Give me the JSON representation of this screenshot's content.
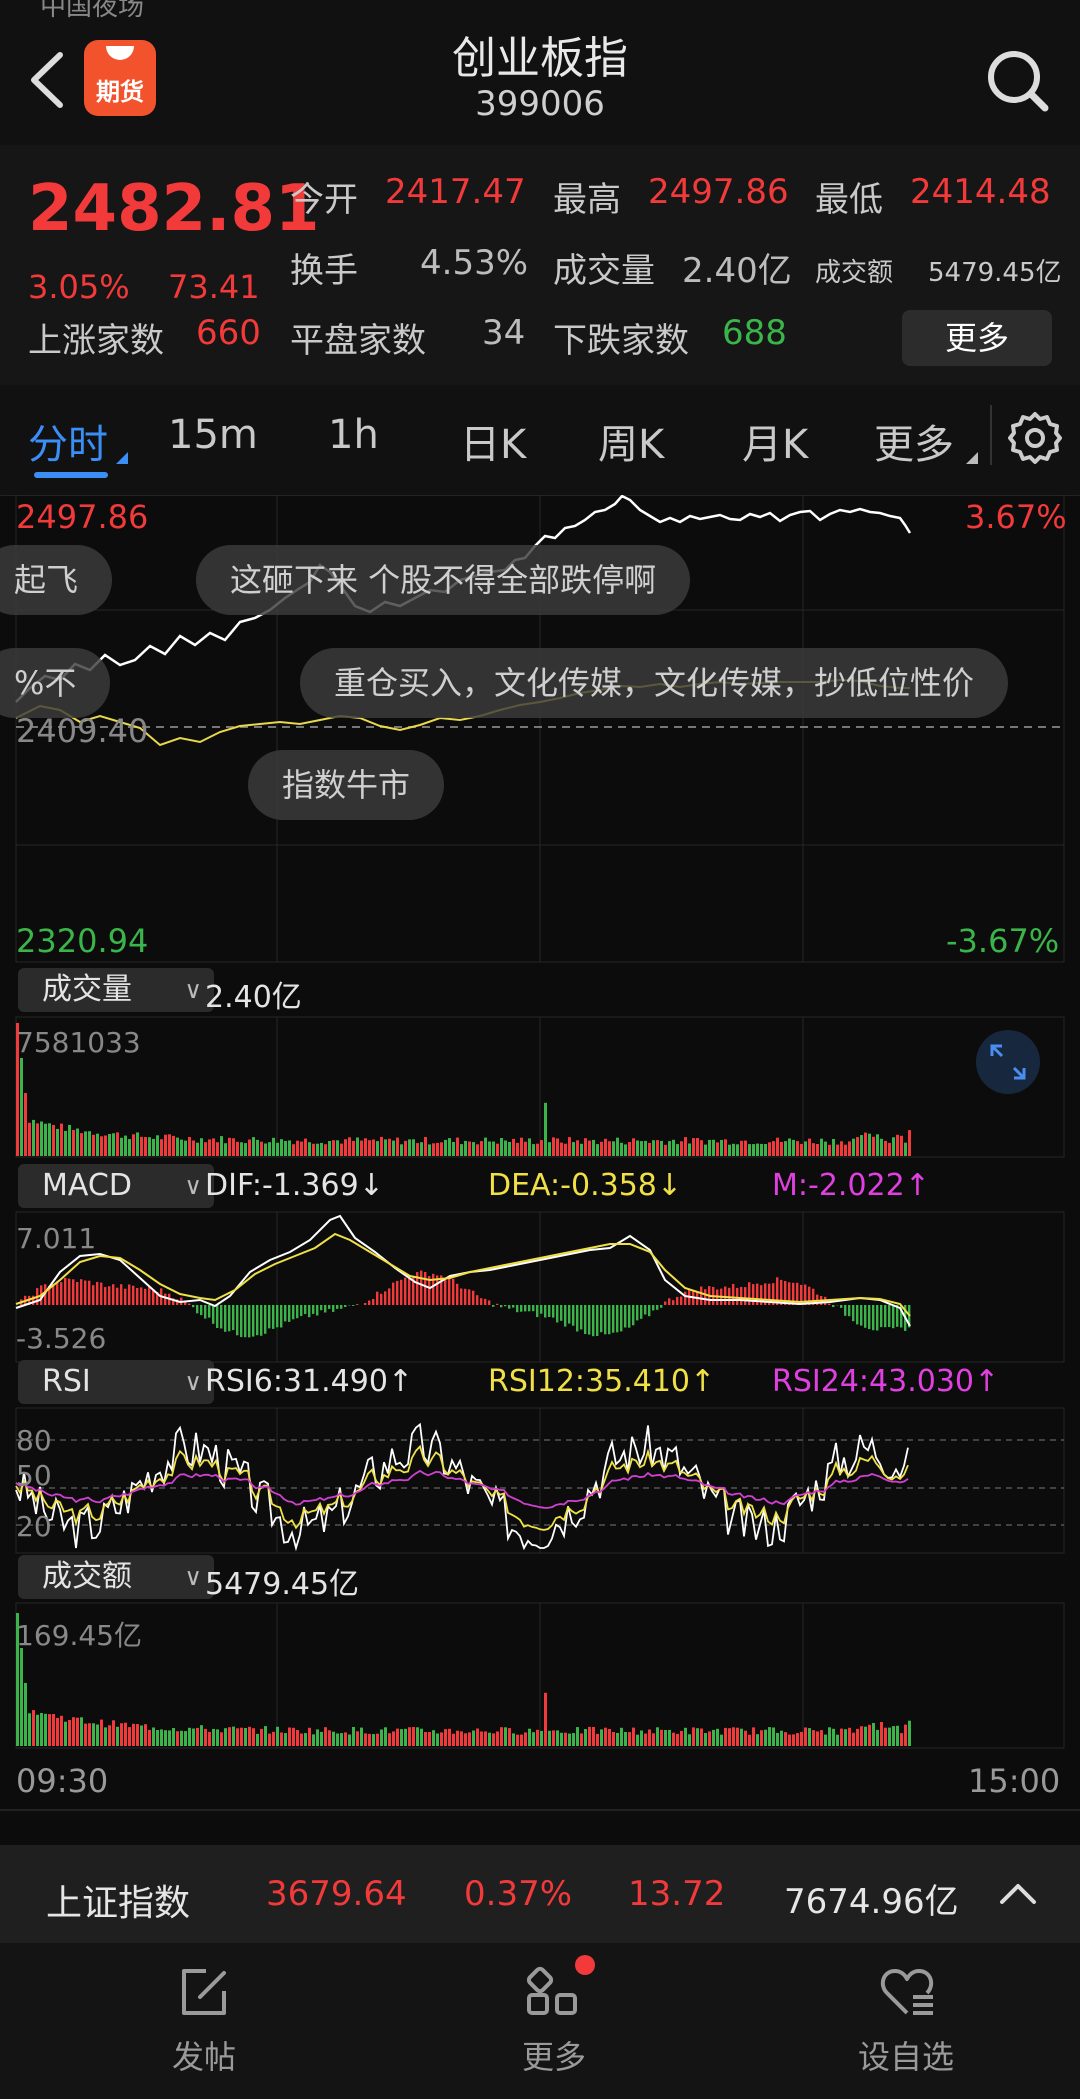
{
  "header": {
    "statusbar_fragment": "中国夜场",
    "logo_text": "期货",
    "title": "创业板指",
    "code": "399006"
  },
  "quote": {
    "price": "2482.81",
    "change_pct": "3.05%",
    "change": "73.41",
    "open_label": "今开",
    "open": "2417.47",
    "high_label": "最高",
    "high": "2497.86",
    "low_label": "最低",
    "low": "2414.48",
    "turnover_label": "换手",
    "turnover": "4.53%",
    "volume_label": "成交量",
    "volume": "2.40亿",
    "amount_label": "成交额",
    "amount": "5479.45亿",
    "up_label": "上涨家数",
    "up": "660",
    "flat_label": "平盘家数",
    "flat": "34",
    "down_label": "下跌家数",
    "down": "688",
    "more_button": "更多"
  },
  "tabs": [
    "分时",
    "15m",
    "1h",
    "日K",
    "周K",
    "月K",
    "更多"
  ],
  "chart": {
    "top_price": "2497.86",
    "top_pct": "3.67%",
    "base_price": "2409.40",
    "bottom_price": "2320.94",
    "bottom_pct": "-3.67%",
    "bubbles": [
      "起飞",
      "这砸下来 个股不得全部跌停啊",
      "%不",
      "重仓买入，文化传媒，文化传媒，抄低位性价",
      "指数牛市"
    ]
  },
  "volume_panel": {
    "selector": "成交量",
    "value": "2.40亿",
    "max_label": "7581033"
  },
  "macd_panel": {
    "selector": "MACD",
    "dif": "DIF:-1.369↓",
    "dea": "DEA:-0.358↓",
    "m": "M:-2.022↑",
    "max_label": "7.011",
    "min_label": "-3.526"
  },
  "rsi_panel": {
    "selector": "RSI",
    "rsi6": "RSI6:31.490↑",
    "rsi12": "RSI12:35.410↑",
    "rsi24": "RSI24:43.030↑",
    "levels": [
      "80",
      "50",
      "20"
    ]
  },
  "amount_panel": {
    "selector": "成交额",
    "value": "5479.45亿",
    "max_label": "169.45亿"
  },
  "time_axis": {
    "start": "09:30",
    "end": "15:00"
  },
  "ticker": {
    "name": "上证指数",
    "price": "3679.64",
    "pct": "0.37%",
    "change": "13.72",
    "amount": "7674.96亿"
  },
  "nav": {
    "post": "发帖",
    "more": "更多",
    "watchlist": "设自选"
  },
  "colors": {
    "up": "#f23a3a",
    "down": "#3bb54a",
    "accent": "#3b8ef5",
    "dea": "#f0e046",
    "m": "#e040e0",
    "price_line": "#ffffff",
    "avg_line": "#e8d84a"
  }
}
